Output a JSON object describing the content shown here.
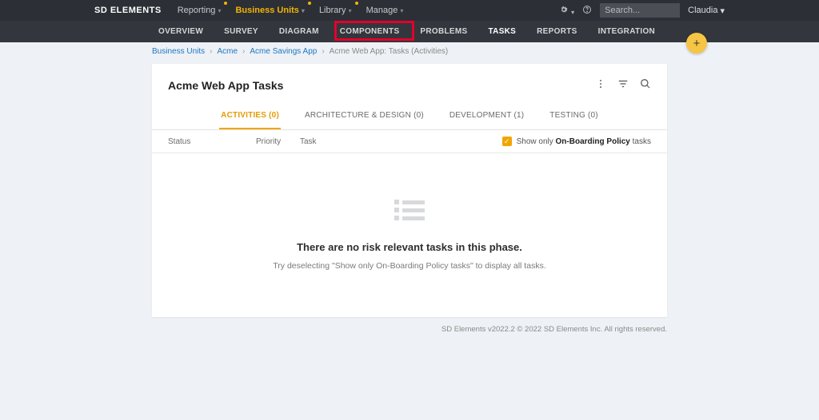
{
  "brand": "SD ELEMENTS",
  "topnav": {
    "reporting": "Reporting",
    "business_units": "Business Units",
    "library": "Library",
    "manage": "Manage"
  },
  "search_placeholder": "Search...",
  "user_name": "Claudia",
  "subnav": {
    "overview": "OVERVIEW",
    "survey": "SURVEY",
    "diagram": "DIAGRAM",
    "components": "COMPONENTS",
    "problems": "PROBLEMS",
    "tasks": "TASKS",
    "reports": "REPORTS",
    "integration": "INTEGRATION"
  },
  "breadcrumb": {
    "a": "Business Units",
    "b": "Acme",
    "c": "Acme Savings App",
    "d": "Acme Web App: Tasks (Activities)"
  },
  "page_title": "Acme Web App Tasks",
  "card_tabs": {
    "activities": "ACTIVITIES (0)",
    "arch": "ARCHITECTURE & DESIGN (0)",
    "dev": "DEVELOPMENT (1)",
    "testing": "TESTING (0)"
  },
  "columns": {
    "status": "Status",
    "priority": "Priority",
    "task": "Task"
  },
  "filter": {
    "prefix": "Show only ",
    "bold": "On-Boarding Policy",
    "suffix": " tasks"
  },
  "empty": {
    "title": "There are no risk relevant tasks in this phase.",
    "hint": "Try deselecting \"Show only On-Boarding Policy tasks\" to display all tasks."
  },
  "footer": "SD Elements v2022.2 © 2022 SD Elements Inc. All rights reserved."
}
